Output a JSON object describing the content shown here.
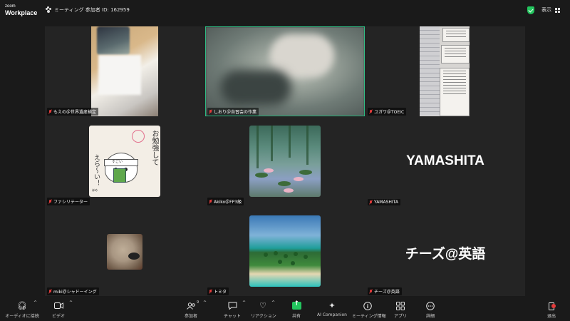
{
  "topbar": {
    "brand_small": "zoom",
    "brand_big": "Workplace",
    "meeting_info": "ミーティング 参加者 ID: 162959",
    "view_label": "表示",
    "colors": {
      "secure": "#23c55e"
    }
  },
  "tiles": [
    {
      "name": "もえの＠世界遺産検定",
      "muted": true,
      "active": false
    },
    {
      "name": "しおり＠自習会の作業",
      "muted": true,
      "active": true
    },
    {
      "name": "ユガワ＠TOEIC",
      "muted": true,
      "active": false
    },
    {
      "name": "ファシリテーター",
      "muted": true,
      "active": false
    },
    {
      "name": "Akiko＠FP3級",
      "muted": true,
      "active": false
    },
    {
      "name": "YAMASHITA",
      "muted": true,
      "active": false,
      "display_text": "YAMASHITA"
    },
    {
      "name": "miki＠シャドーイング",
      "muted": true,
      "active": false
    },
    {
      "name": "トミタ",
      "muted": true,
      "active": false
    },
    {
      "name": "チーズ＠英語",
      "muted": true,
      "active": false,
      "display_text": "チーズ@英語"
    }
  ],
  "fasi_sticker": {
    "text_right": "お勉強して",
    "text_left": "えら〜い！",
    "band_text": "すごい",
    "signature": "ほめ"
  },
  "toolbar": {
    "audio": "オーディオに接続",
    "video": "ビデオ",
    "participants": "参加者",
    "participants_count": "9",
    "chat": "チャット",
    "reactions": "リアクション",
    "share": "共有",
    "ai": "AI Companion",
    "info": "ミーティング情報",
    "apps": "アプリ",
    "more": "詳細",
    "leave": "退出",
    "colors": {
      "share": "#23c55e",
      "leave": "#e23b3b"
    }
  },
  "colors": {
    "active_border": "#23d18b",
    "mute": "#e03b3b",
    "stage_bg": "#242424"
  }
}
